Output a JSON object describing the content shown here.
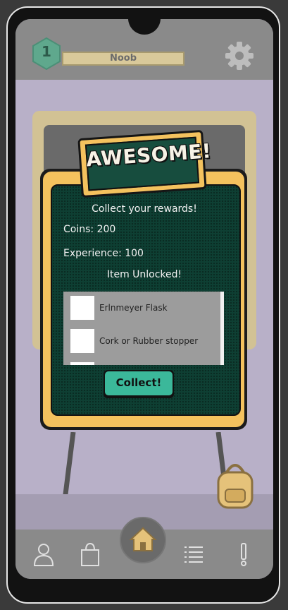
{
  "header": {
    "level": "1",
    "rank": "Noob"
  },
  "modal": {
    "title": "AWESOME!",
    "subtitle": "Collect your rewards!",
    "coins_line": "Coins: 200",
    "experience_line": "Experience: 100",
    "unlocked_heading": "Item Unlocked!",
    "items": [
      {
        "label": "Erlnmeyer Flask"
      },
      {
        "label": "Cork or Rubber stopper"
      },
      {
        "label": ""
      }
    ],
    "collect_label": "Collect!"
  },
  "colors": {
    "board_green": "#0e3f33",
    "frame_gold": "#f4c25e",
    "button_teal": "#3bb89a",
    "overlay_gray": "#8a8a8a"
  },
  "icons": {
    "settings": "gear-icon",
    "home": "home-icon",
    "profile": "user-icon",
    "shop": "shopping-bag-icon",
    "list": "list-icon",
    "alert": "exclamation-icon",
    "backpack": "backpack-icon"
  }
}
